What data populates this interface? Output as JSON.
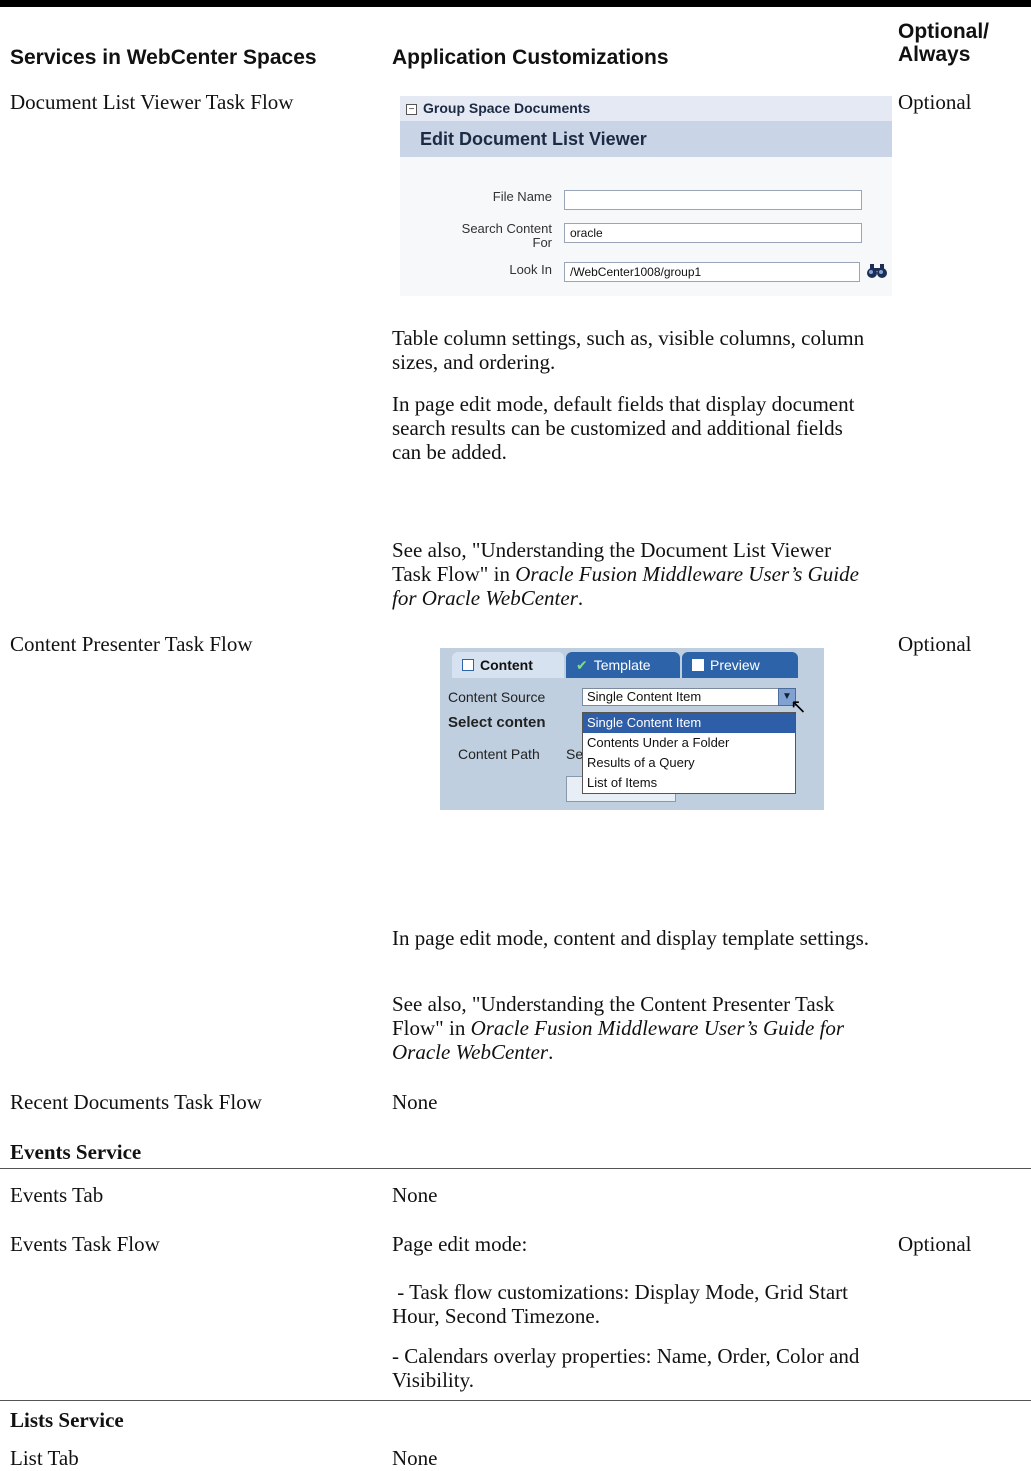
{
  "headers": {
    "col1": "Services in WebCenter Spaces",
    "col2": "Application Customizations",
    "col3_line1": "Optional/",
    "col3_line2": "Always"
  },
  "rows": {
    "doc_list_viewer": {
      "service": "Document List Viewer Task Flow",
      "optional": "Optional",
      "para1": "Table column settings, such as, visible columns, column sizes, and ordering.",
      "para2": "In page edit mode, default fields that display document search results can be customized and additional fields can be added.",
      "para3_prefix": "See also, \"Understanding the Document List Viewer Task Flow\" in ",
      "para3_italic": "Oracle Fusion Middleware User’s Guide for Oracle WebCenter",
      "para3_suffix": "."
    },
    "content_presenter": {
      "service": "Content Presenter Task Flow",
      "optional": "Optional",
      "para1": "In page edit mode, content and display template settings.",
      "para2_prefix": "See also, \"Understanding the Content Presenter Task Flow\" in ",
      "para2_italic": "Oracle Fusion Middleware User’s Guide for Oracle WebCenter",
      "para2_suffix": "."
    },
    "recent_documents": {
      "service": "Recent Documents Task Flow",
      "customization": "None"
    },
    "events_section": "Events Service",
    "events_tab": {
      "service": "Events Tab",
      "customization": "None"
    },
    "events_task_flow": {
      "service": "Events Task Flow",
      "para1": "Page edit mode:",
      "para2": " - Task flow customizations: Display Mode, Grid Start Hour, Second Timezone.",
      "para3": "- Calendars overlay properties: Name, Order, Color and Visibility.",
      "optional": "Optional"
    },
    "lists_section": "Lists Service",
    "list_tab": {
      "service": "List Tab",
      "customization": "None"
    }
  },
  "screenshot1": {
    "group_title": "Group Space Documents",
    "collapse_glyph": "−",
    "panel_title": "Edit Document List Viewer",
    "file_name_label": "File Name",
    "file_name_value": "",
    "search_label_line1": "Search Content",
    "search_label_line2": "For",
    "search_value": "oracle",
    "look_in_label": "Look In",
    "look_in_value": "/WebCenter1008/group1",
    "icon": "binoculars-icon"
  },
  "screenshot2": {
    "tabs": [
      "Content",
      "Template",
      "Preview"
    ],
    "template_check": "✔",
    "content_source_label": "Content Source",
    "content_source_value": "Single Content Item",
    "select_content_label": "Select conten",
    "content_path_label": "Content Path",
    "content_path_value": "Se",
    "options": [
      "Single Content Item",
      "Contents Under a Folder",
      "Results of a Query",
      "List of Items"
    ],
    "dropdown_glyph": "▼",
    "cursor_glyph": "↖"
  }
}
